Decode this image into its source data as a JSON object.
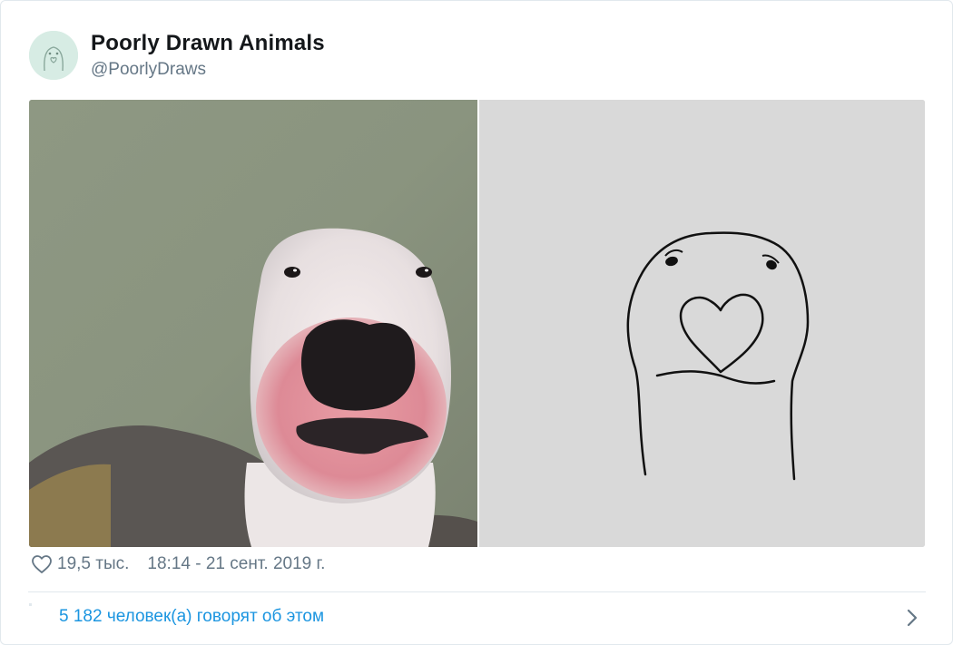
{
  "author": {
    "name": "Poorly Drawn Animals",
    "handle": "@PoorlyDraws",
    "avatar_icon": "cartoon-animal-avatar"
  },
  "media": {
    "left_image": "photo-bull-terrier-face",
    "right_image": "drawing-bull-terrier-face"
  },
  "meta": {
    "likes": "19,5 тыс.",
    "timestamp": "18:14 - 21 сент. 2019 г."
  },
  "footer": {
    "talking_text": "5 182 человек(а) говорят об этом"
  },
  "colors": {
    "link": "#1b95e0",
    "muted": "#657786",
    "text": "#14171a",
    "border": "#e1e8ed"
  }
}
